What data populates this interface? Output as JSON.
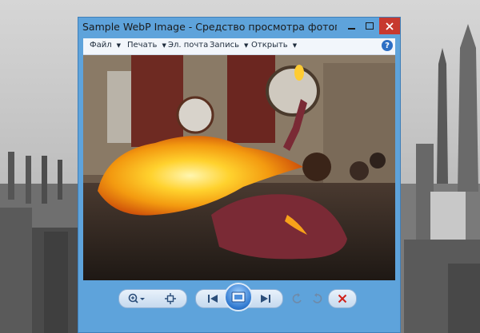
{
  "window": {
    "title": "Sample WebP Image - Средство просмотра фотографий ..."
  },
  "menubar": {
    "items": [
      {
        "label": "Файл"
      },
      {
        "label": "Печать"
      },
      {
        "label": "Эл. почта"
      },
      {
        "label": "Запись"
      },
      {
        "label": "Открыть"
      }
    ],
    "help_label": "?"
  },
  "toolbar": {
    "buttons": [
      "zoom-icon",
      "fit-to-window-icon",
      "previous-icon",
      "slideshow-icon",
      "next-icon",
      "rotate-left-icon",
      "rotate-right-icon",
      "delete-icon"
    ]
  },
  "colors": {
    "window_frame": "#5ea3db",
    "close_button": "#c7392f",
    "delete_icon": "#d0201a"
  }
}
